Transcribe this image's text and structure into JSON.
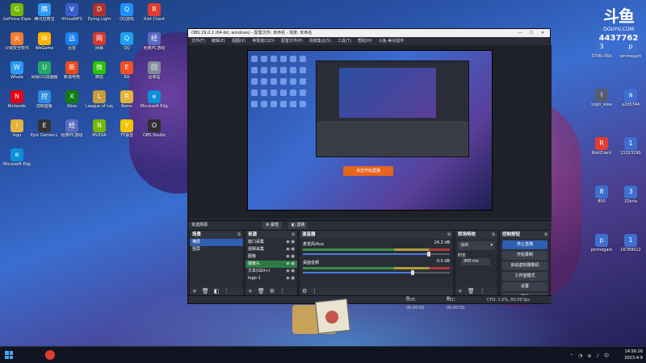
{
  "desktop": {
    "left_icons": [
      {
        "label": "GeForce Experience",
        "color": "#76b900",
        "glyph": "G"
      },
      {
        "label": "腾讯应用宝",
        "color": "#2b9bf4",
        "glyph": "腾"
      },
      {
        "label": "VirtualNFS",
        "color": "#3a5fcd",
        "glyph": "V"
      },
      {
        "label": "Dying Light",
        "color": "#b0322b",
        "glyph": "D"
      },
      {
        "label": "QQ游戏",
        "color": "#1e90ff",
        "glyph": "Q"
      },
      {
        "label": "Riot Client",
        "color": "#e03c31",
        "glyph": "R"
      },
      {
        "label": "火绒安全软件",
        "color": "#f27c2e",
        "glyph": "火"
      },
      {
        "label": "WeGame",
        "color": "#ffb400",
        "glyph": "W"
      },
      {
        "label": "迅雷",
        "color": "#1b7ef0",
        "glyph": "迅"
      },
      {
        "label": "网易",
        "color": "#d33b33",
        "glyph": "网"
      },
      {
        "label": "QQ",
        "color": "#1ca0f2",
        "glyph": "Q"
      },
      {
        "label": "经典PC游戏",
        "color": "#5c6bc0",
        "glyph": "经"
      },
      {
        "label": "Whale",
        "color": "#2b9bf4",
        "glyph": "W"
      },
      {
        "label": "网易UU加速器",
        "color": "#22aa66",
        "glyph": "U"
      },
      {
        "label": "新浪电竞",
        "color": "#e64a19",
        "glyph": "新"
      },
      {
        "label": "微信",
        "color": "#2dc100",
        "glyph": "微"
      },
      {
        "label": "EA",
        "color": "#f25022",
        "glyph": "E"
      },
      {
        "label": "回收站",
        "color": "#7f8c9d",
        "glyph": "回"
      },
      {
        "label": "Nintendo",
        "color": "#e60012",
        "glyph": "N"
      },
      {
        "label": "控制面板",
        "color": "#2b8be0",
        "glyph": "控"
      },
      {
        "label": "Xbox",
        "color": "#107c10",
        "glyph": "X"
      },
      {
        "label": "League of Legends",
        "color": "#c89b3c",
        "glyph": "L"
      },
      {
        "label": "Roms",
        "color": "#e5b23c",
        "glyph": "R"
      },
      {
        "label": "Microsoft Edge",
        "color": "#0c8fd8",
        "glyph": "e"
      },
      {
        "label": "logo",
        "color": "#e5b23c",
        "glyph": "l"
      },
      {
        "label": "Epic Games Launcher",
        "color": "#333333",
        "glyph": "E"
      },
      {
        "label": "经典PC游戏",
        "color": "#5c6bc0",
        "glyph": "经"
      },
      {
        "label": "NVIDIA",
        "color": "#76b900",
        "glyph": "N"
      },
      {
        "label": "YY语音",
        "color": "#f5c400",
        "glyph": "Y"
      },
      {
        "label": "OBS Studio",
        "color": "#302e31",
        "glyph": "O"
      },
      {
        "label": "Microsoft Edge",
        "color": "#0c8fd8",
        "glyph": "e"
      }
    ],
    "right_icons": [
      {
        "label": "3706c36b",
        "color": "#3d6fd1",
        "glyph": "3"
      },
      {
        "label": "pinmegam",
        "color": "#3d6fd1",
        "glyph": "p"
      },
      {
        "label": "login_stea",
        "color": "#555e70",
        "glyph": "l"
      },
      {
        "label": "a2d5744",
        "color": "#3d6fd1",
        "glyph": "a"
      },
      {
        "label": "RiotClient",
        "color": "#e03c31",
        "glyph": "R"
      },
      {
        "label": "15323290",
        "color": "#3d6fd1",
        "glyph": "1"
      },
      {
        "label": "800",
        "color": "#3d6fd1",
        "glyph": "8"
      },
      {
        "label": "32eria",
        "color": "#3d6fd1",
        "glyph": "3"
      },
      {
        "label": "pinmegam",
        "color": "#3d6fd1",
        "glyph": "p"
      },
      {
        "label": "16789012",
        "color": "#3d6fd1",
        "glyph": "1"
      }
    ]
  },
  "brand": {
    "logo": "斗鱼",
    "site": "DOUYU.COM",
    "room_id": "4437762"
  },
  "obs": {
    "title": "OBS 29.0.2 (64-bit, windows) - 配置文件: 未命名 - 场景: 未命名",
    "menu": [
      "文件(F)",
      "编辑(E)",
      "视图(V)",
      "停靠窗口(D)",
      "配置文件(P)",
      "场景集合(S)",
      "工具(T)",
      "帮助(H)",
      "斗鱼-美化插件"
    ],
    "preview_button": "点击开始直播",
    "no_source": "未选择源",
    "properties_label": "属性",
    "filters_label": "滤镜",
    "scenes": {
      "title": "场景",
      "items": [
        "横屏",
        "竖屏"
      ]
    },
    "sources": {
      "title": "来源",
      "items": [
        "窗口采集",
        "视频采集",
        "图像",
        "摄像头",
        "文本(GDI+)",
        "logo-1"
      ]
    },
    "mixer": {
      "title": "混音器",
      "channels": [
        {
          "name": "麦克风/Aux",
          "db": "24.2 dB",
          "level": 0.85
        },
        {
          "name": "桌面音频",
          "db": "0.0 dB",
          "level": 0.74
        }
      ]
    },
    "transitions": {
      "title": "转场特效",
      "type": "淡出",
      "duration_label": "时长",
      "duration_value": "300 ms"
    },
    "controls": {
      "title": "控制按钮",
      "buttons": [
        "停止直播",
        "开始录制",
        "启动虚拟摄像机",
        "工作室模式",
        "设置",
        "退出"
      ]
    },
    "status": {
      "live": "LIVE: 00:00:00",
      "rec": "REC: 00:00:00",
      "cpu": "CPU: 1.5%, 60.00 fps"
    }
  },
  "taskbar": {
    "search_placeholder": "",
    "time": "14:56:16",
    "date": "2023-4-9"
  }
}
